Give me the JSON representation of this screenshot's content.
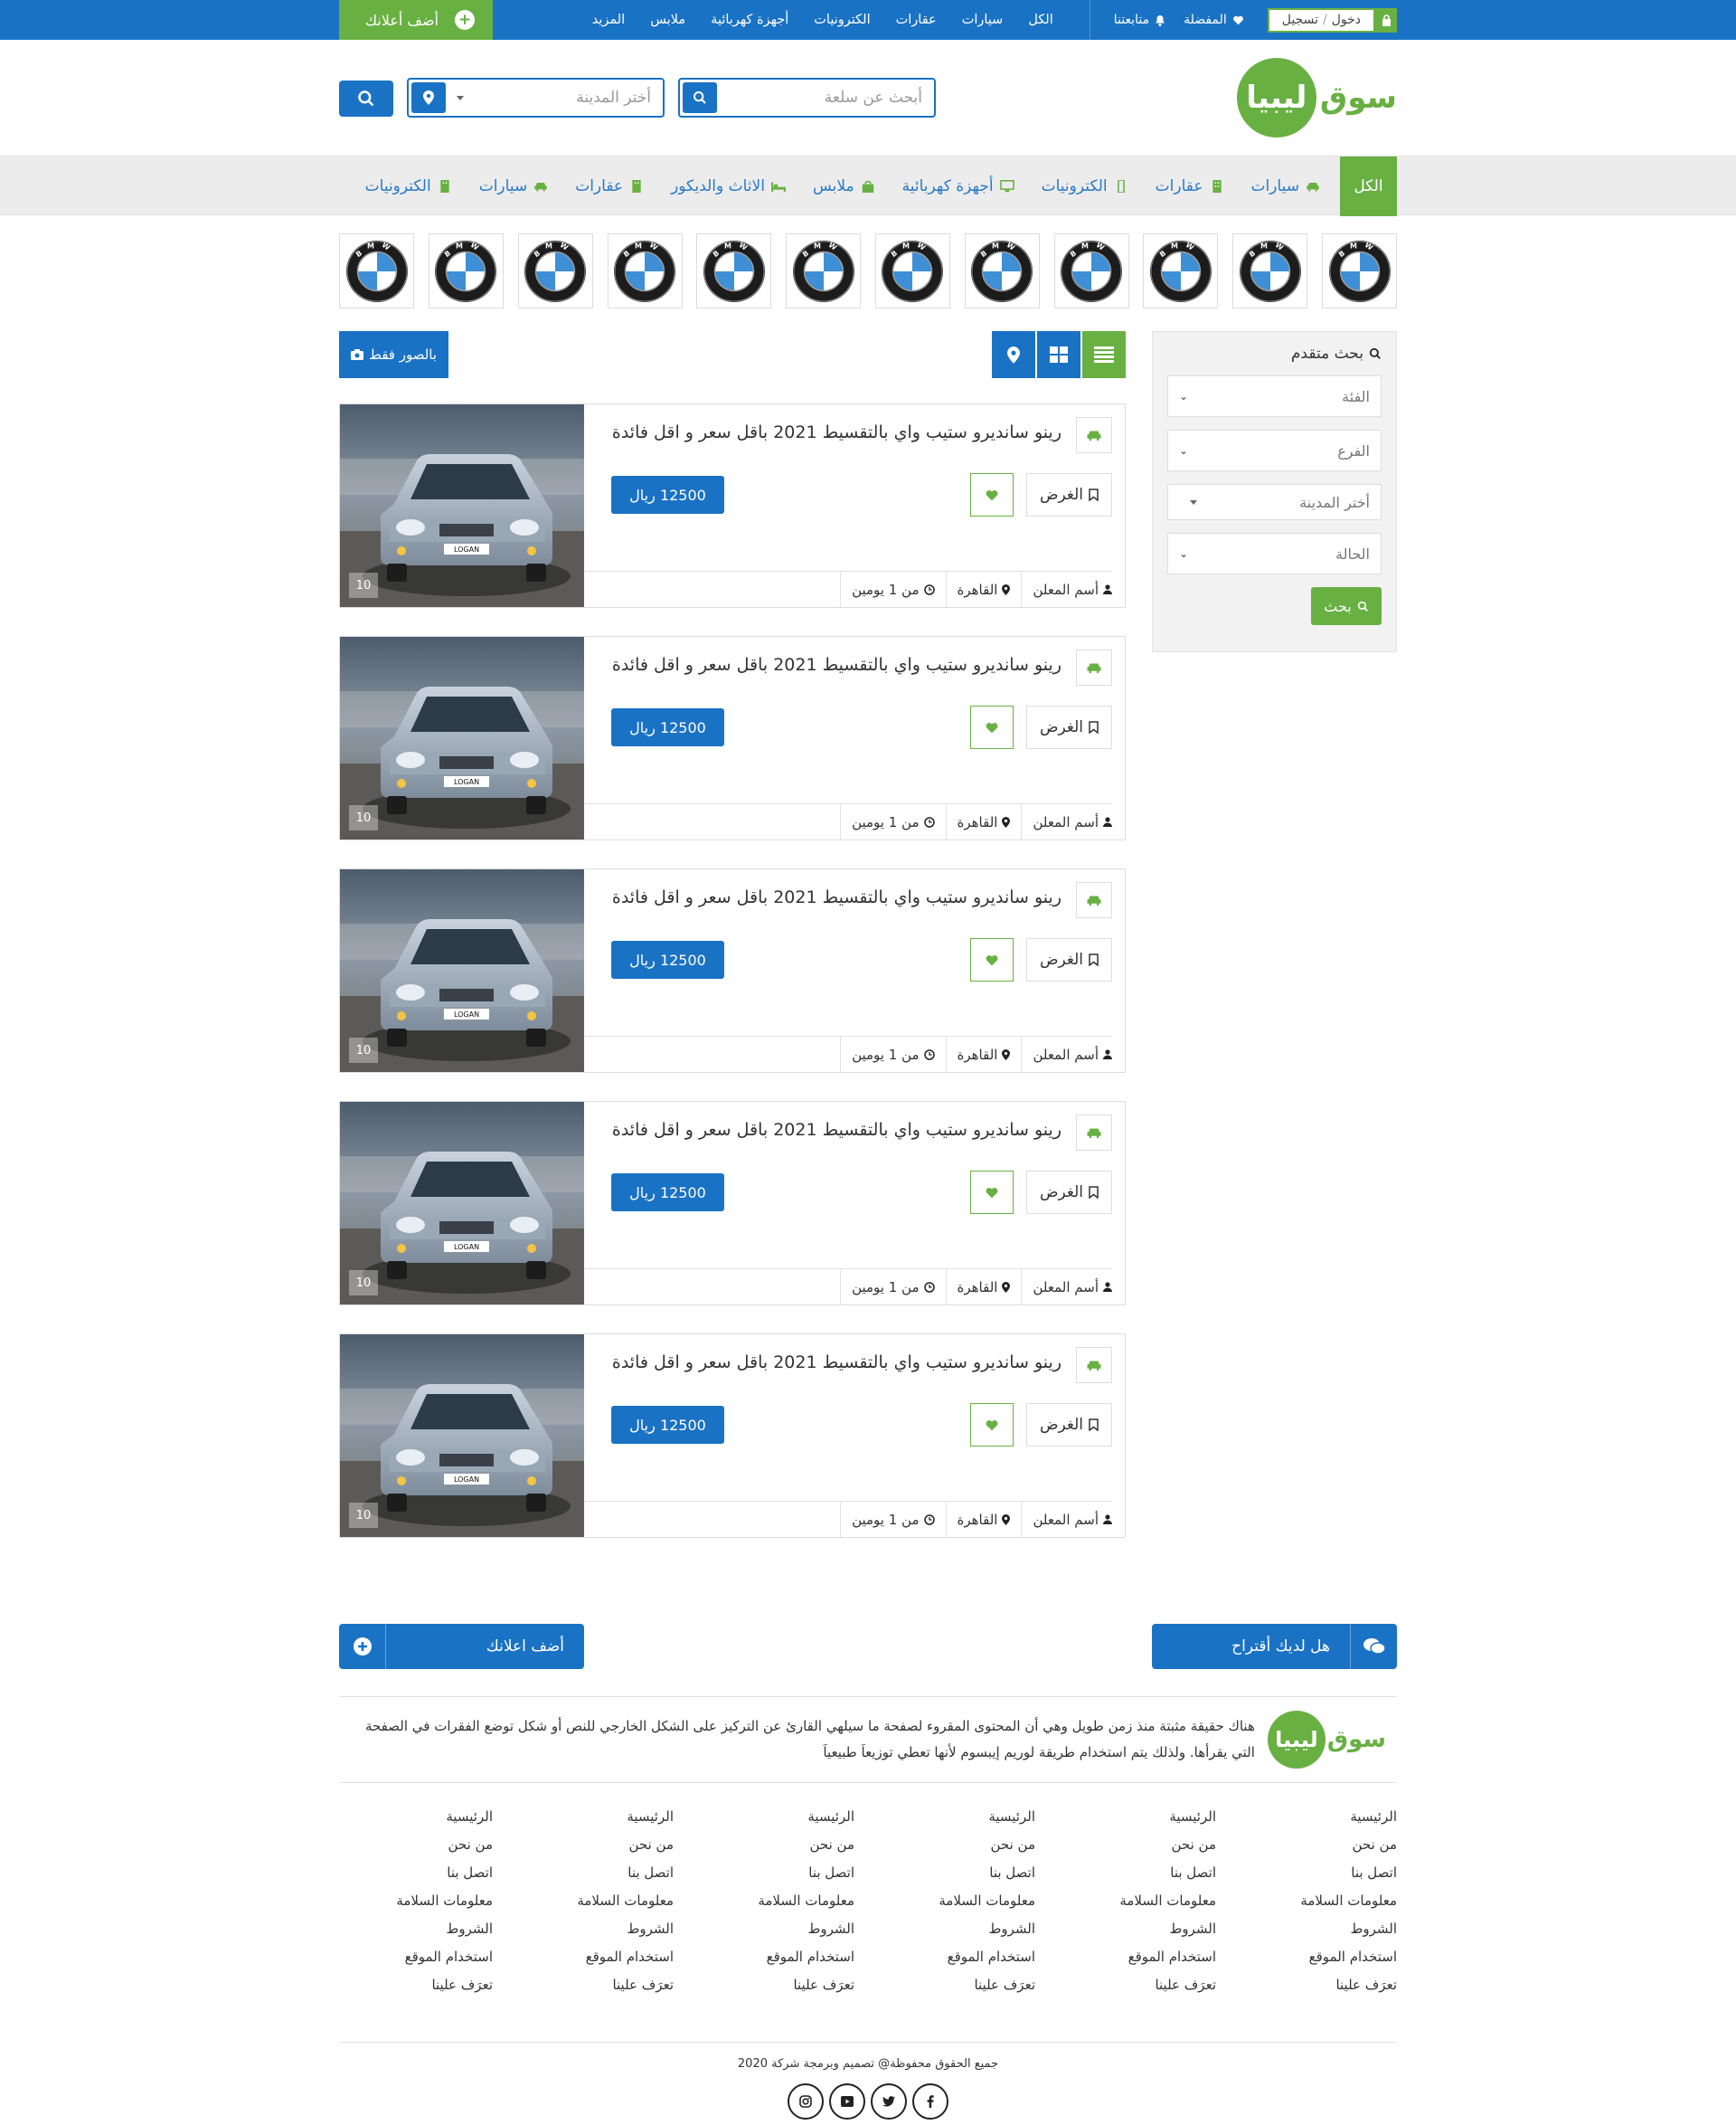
{
  "topbar": {
    "login": "دخول",
    "login_sep": "/",
    "register": "تسجيل",
    "favorites": "المفضلة",
    "following": "متابعتنا",
    "nav": [
      "الكل",
      "سيارات",
      "عقارات",
      "الكترونيات",
      "أجهزة كهربائية",
      "ملابس",
      "المزيد"
    ],
    "add_ad": "أضف أعلانك"
  },
  "header": {
    "logo_a": "سوق",
    "logo_b": "ليبيا",
    "search_placeholder": "أبحث عن سلعة",
    "city_placeholder": "أختر المدينة"
  },
  "catnav": {
    "all": "الكل",
    "items": [
      {
        "label": "سيارات",
        "icon": "car-icon"
      },
      {
        "label": "عقارات",
        "icon": "building-icon"
      },
      {
        "label": "الكترونيات",
        "icon": "mobile-icon"
      },
      {
        "label": "أجهزة كهربائية",
        "icon": "monitor-icon"
      },
      {
        "label": "ملابس",
        "icon": "shopping-bag-icon"
      },
      {
        "label": "الاثاث والديكور",
        "icon": "bed-icon"
      },
      {
        "label": "عقارات",
        "icon": "building-icon"
      },
      {
        "label": "سيارات",
        "icon": "car-icon"
      },
      {
        "label": "الكترونيات",
        "icon": "building-icon"
      }
    ]
  },
  "brands": {
    "count": 12,
    "letters": "BMW"
  },
  "sidebar": {
    "title": "بحث متقدم",
    "category": "الفئة",
    "branch": "الفرع",
    "city": "أختر المدينة",
    "condition": "الحالة",
    "search_btn": "بحث"
  },
  "toolbar": {
    "photos_only": "بالصور فقط"
  },
  "listings": [
    {
      "title": "رينو سانديرو ستيب واي بالتقسيط 2021 باقل سعر و اقل فائدة",
      "offer": "الغرض",
      "price": "12500 ريال",
      "advertiser": "أسم المعلن",
      "city": "القاهرة",
      "time": "من 1 يومين",
      "img_count": "10"
    },
    {
      "title": "رينو سانديرو ستيب واي بالتقسيط 2021 باقل سعر و اقل فائدة",
      "offer": "الغرض",
      "price": "12500 ريال",
      "advertiser": "أسم المعلن",
      "city": "القاهرة",
      "time": "من 1 يومين",
      "img_count": "10"
    },
    {
      "title": "رينو سانديرو ستيب واي بالتقسيط 2021 باقل سعر و اقل فائدة",
      "offer": "الغرض",
      "price": "12500 ريال",
      "advertiser": "أسم المعلن",
      "city": "القاهرة",
      "time": "من 1 يومين",
      "img_count": "10"
    },
    {
      "title": "رينو سانديرو ستيب واي بالتقسيط 2021 باقل سعر و اقل فائدة",
      "offer": "الغرض",
      "price": "12500 ريال",
      "advertiser": "أسم المعلن",
      "city": "القاهرة",
      "time": "من 1 يومين",
      "img_count": "10"
    },
    {
      "title": "رينو سانديرو ستيب واي بالتقسيط 2021 باقل سعر و اقل فائدة",
      "offer": "الغرض",
      "price": "12500 ريال",
      "advertiser": "أسم المعلن",
      "city": "القاهرة",
      "time": "من 1 يومين",
      "img_count": "10"
    }
  ],
  "cta": {
    "suggest": "هل لديك أقتراح",
    "add_ad": "أضف اعلانك"
  },
  "footer": {
    "about": "هناك حقيقة مثبتة منذ زمن طويل وهي أن المحتوى المقروء لصفحة ما سيلهي القارئ عن التركيز على الشكل الخارجي للنص أو شكل توضع الفقرات في الصفحة التي يقرأها. ولذلك يتم استخدام طريقة لوريم إيبسوم لأنها تعطي توزيعاَ طبيعياَ",
    "columns": [
      [
        "الرئيسية",
        "من نحن",
        "اتصل بنا",
        "معلومات السلامة",
        "الشروط",
        "استخدام الموقع",
        "تعرَف علينا"
      ],
      [
        "الرئيسية",
        "من نحن",
        "اتصل بنا",
        "معلومات السلامة",
        "الشروط",
        "استخدام الموقع",
        "تعرَف علينا"
      ],
      [
        "الرئيسية",
        "من نحن",
        "اتصل بنا",
        "معلومات السلامة",
        "الشروط",
        "استخدام الموقع",
        "تعرَف علينا"
      ],
      [
        "الرئيسية",
        "من نحن",
        "اتصل بنا",
        "معلومات السلامة",
        "الشروط",
        "استخدام الموقع",
        "تعرَف علينا"
      ],
      [
        "الرئيسية",
        "من نحن",
        "اتصل بنا",
        "معلومات السلامة",
        "الشروط",
        "استخدام الموقع",
        "تعرَف علينا"
      ],
      [
        "الرئيسية",
        "من نحن",
        "اتصل بنا",
        "معلومات السلامة",
        "الشروط",
        "استخدام الموقع",
        "تعرَف علينا"
      ]
    ],
    "copyright": "جميع الحقوق محفوظة@ تصميم وبرمجة شركة 2020",
    "social": [
      "facebook-icon",
      "twitter-icon",
      "youtube-icon",
      "instagram-icon"
    ]
  },
  "colors": {
    "primary": "#1a72c4",
    "accent": "#69b043"
  }
}
